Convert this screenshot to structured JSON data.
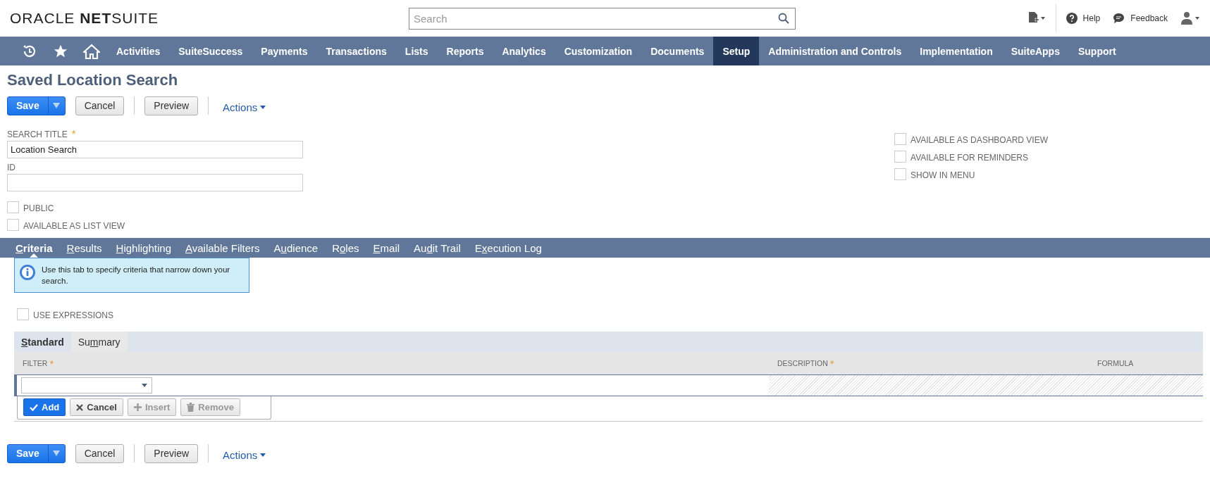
{
  "header": {
    "logo": "ORACLE **NET**SUITE",
    "search": {
      "placeholder": "Search"
    },
    "links": [
      {
        "kind": "help",
        "label": "Help"
      },
      {
        "kind": "feedback",
        "label": "Feedback"
      }
    ]
  },
  "nav": {
    "items": [
      {
        "label": "Activities",
        "selected": false
      },
      {
        "label": "SuiteSuccess",
        "selected": false
      },
      {
        "label": "Payments",
        "selected": false
      },
      {
        "label": "Transactions",
        "selected": false
      },
      {
        "label": "Lists",
        "selected": false
      },
      {
        "label": "Reports",
        "selected": false
      },
      {
        "label": "Analytics",
        "selected": false
      },
      {
        "label": "Customization",
        "selected": false
      },
      {
        "label": "Documents",
        "selected": false
      },
      {
        "label": "Setup",
        "selected": true
      },
      {
        "label": "Administration and Controls",
        "selected": false
      },
      {
        "label": "Implementation",
        "selected": false
      },
      {
        "label": "SuiteApps",
        "selected": false
      },
      {
        "label": "Support",
        "selected": false
      }
    ]
  },
  "page_title": "Saved Location Search",
  "top_buttons": {
    "save": "Save",
    "cancel": "Cancel",
    "preview": "Preview",
    "actions": "Actions"
  },
  "form": {
    "search_title": {
      "label": "SEARCH TITLE",
      "required_mark": "*",
      "value": "Location Search"
    },
    "id": {
      "label": "ID"
    },
    "left_checks": [
      {
        "label": "PUBLIC",
        "checked": false
      },
      {
        "label": "AVAILABLE AS LIST VIEW",
        "checked": false
      }
    ],
    "right_checks": [
      {
        "label": "AVAILABLE AS DASHBOARD VIEW",
        "checked": false
      },
      {
        "label": "AVAILABLE FOR REMINDERS",
        "checked": false
      },
      {
        "label": "SHOW IN MENU",
        "checked": false
      }
    ]
  },
  "tabs": [
    {
      "key": "C",
      "post": "riteria",
      "selected": true
    },
    {
      "key": "R",
      "post": "esults",
      "selected": false
    },
    {
      "key": "H",
      "post": "ighlighting",
      "selected": false
    },
    {
      "key": "A",
      "post": "vailable Filters",
      "selected": false
    },
    {
      "pre": "A",
      "key": "u",
      "post": "dience",
      "selected": false
    },
    {
      "pre": "R",
      "key": "o",
      "post": "les",
      "selected": false
    },
    {
      "key": "E",
      "post": "mail",
      "selected": false
    },
    {
      "pre": "Au",
      "key": "d",
      "post": "it Trail",
      "selected": false
    },
    {
      "pre": "E",
      "key": "x",
      "post": "ecution Log",
      "selected": false
    }
  ],
  "info": "Use this tab to specify criteria that narrow down your search.",
  "use_expressions": {
    "label": "USE EXPRESSIONS",
    "checked": false
  },
  "subtabs": [
    {
      "key": "S",
      "post": "tandard",
      "selected": true
    },
    {
      "pre": "Su",
      "key": "m",
      "post": "mary",
      "selected": false
    }
  ],
  "columns": [
    {
      "label": "FILTER",
      "required_mark": "*"
    },
    {
      "label": "DESCRIPTION",
      "required_mark": "*"
    },
    {
      "label": "FORMULA"
    }
  ],
  "row_buttons": [
    {
      "kind": "add",
      "label": "Add",
      "disabled": false
    },
    {
      "kind": "cancel",
      "label": "Cancel",
      "disabled": false
    },
    {
      "kind": "insert",
      "label": "Insert",
      "disabled": true
    },
    {
      "kind": "remove",
      "label": "Remove",
      "disabled": true
    }
  ],
  "bottom_buttons": {
    "save": "Save",
    "cancel": "Cancel",
    "preview": "Preview",
    "actions": "Actions"
  }
}
